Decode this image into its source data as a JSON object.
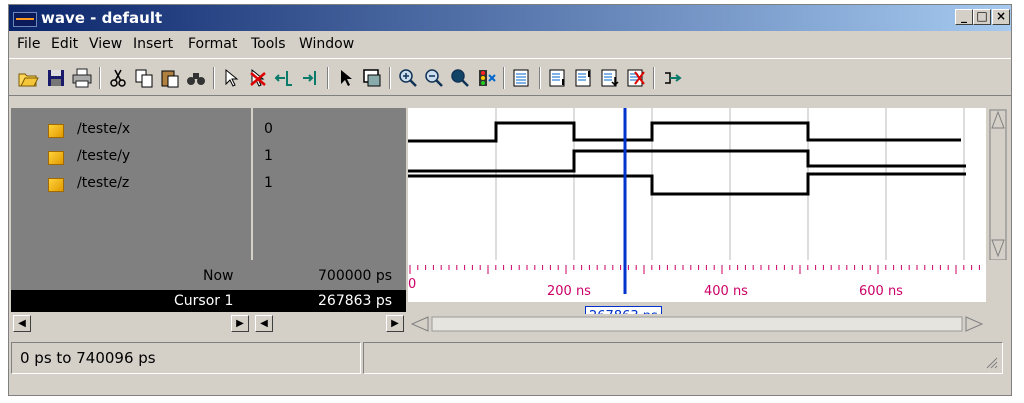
{
  "window": {
    "title": "wave - default",
    "minimize": "_",
    "maximize": "□",
    "close": "×"
  },
  "menu": [
    "File",
    "Edit",
    "View",
    "Insert",
    "Format",
    "Tools",
    "Window"
  ],
  "toolbar_icons": [
    "open-icon",
    "save-icon",
    "print-icon",
    "cut-icon",
    "copy-icon",
    "paste-icon",
    "find-icon",
    "select-icon",
    "delete-icon",
    "insert-left-icon",
    "insert-right-icon",
    "pointer-icon",
    "zoom-box-icon",
    "zoom-in-icon",
    "zoom-out-icon",
    "zoom-full-icon",
    "stop-icon",
    "group-icon",
    "align-left-icon",
    "align-right-icon",
    "add-icon",
    "remove-icon",
    "cursor-icon"
  ],
  "signals": [
    {
      "name": "/teste/x",
      "value": "0"
    },
    {
      "name": "/teste/y",
      "value": "1"
    },
    {
      "name": "/teste/z",
      "value": "1"
    }
  ],
  "now_label": "Now",
  "now_value": "700000 ps",
  "cursor_label": "Cursor 1",
  "cursor_value": "267863 ps",
  "ruler": {
    "ticks": [
      "200 ns",
      "400 ns",
      "600 ns"
    ]
  },
  "status_left": "0 ps to 740096 ps",
  "colors": {
    "cursor": "#0033cc",
    "title_start": "#0a246a",
    "title_end": "#a6caf0",
    "ruler": "#cc0066"
  }
}
